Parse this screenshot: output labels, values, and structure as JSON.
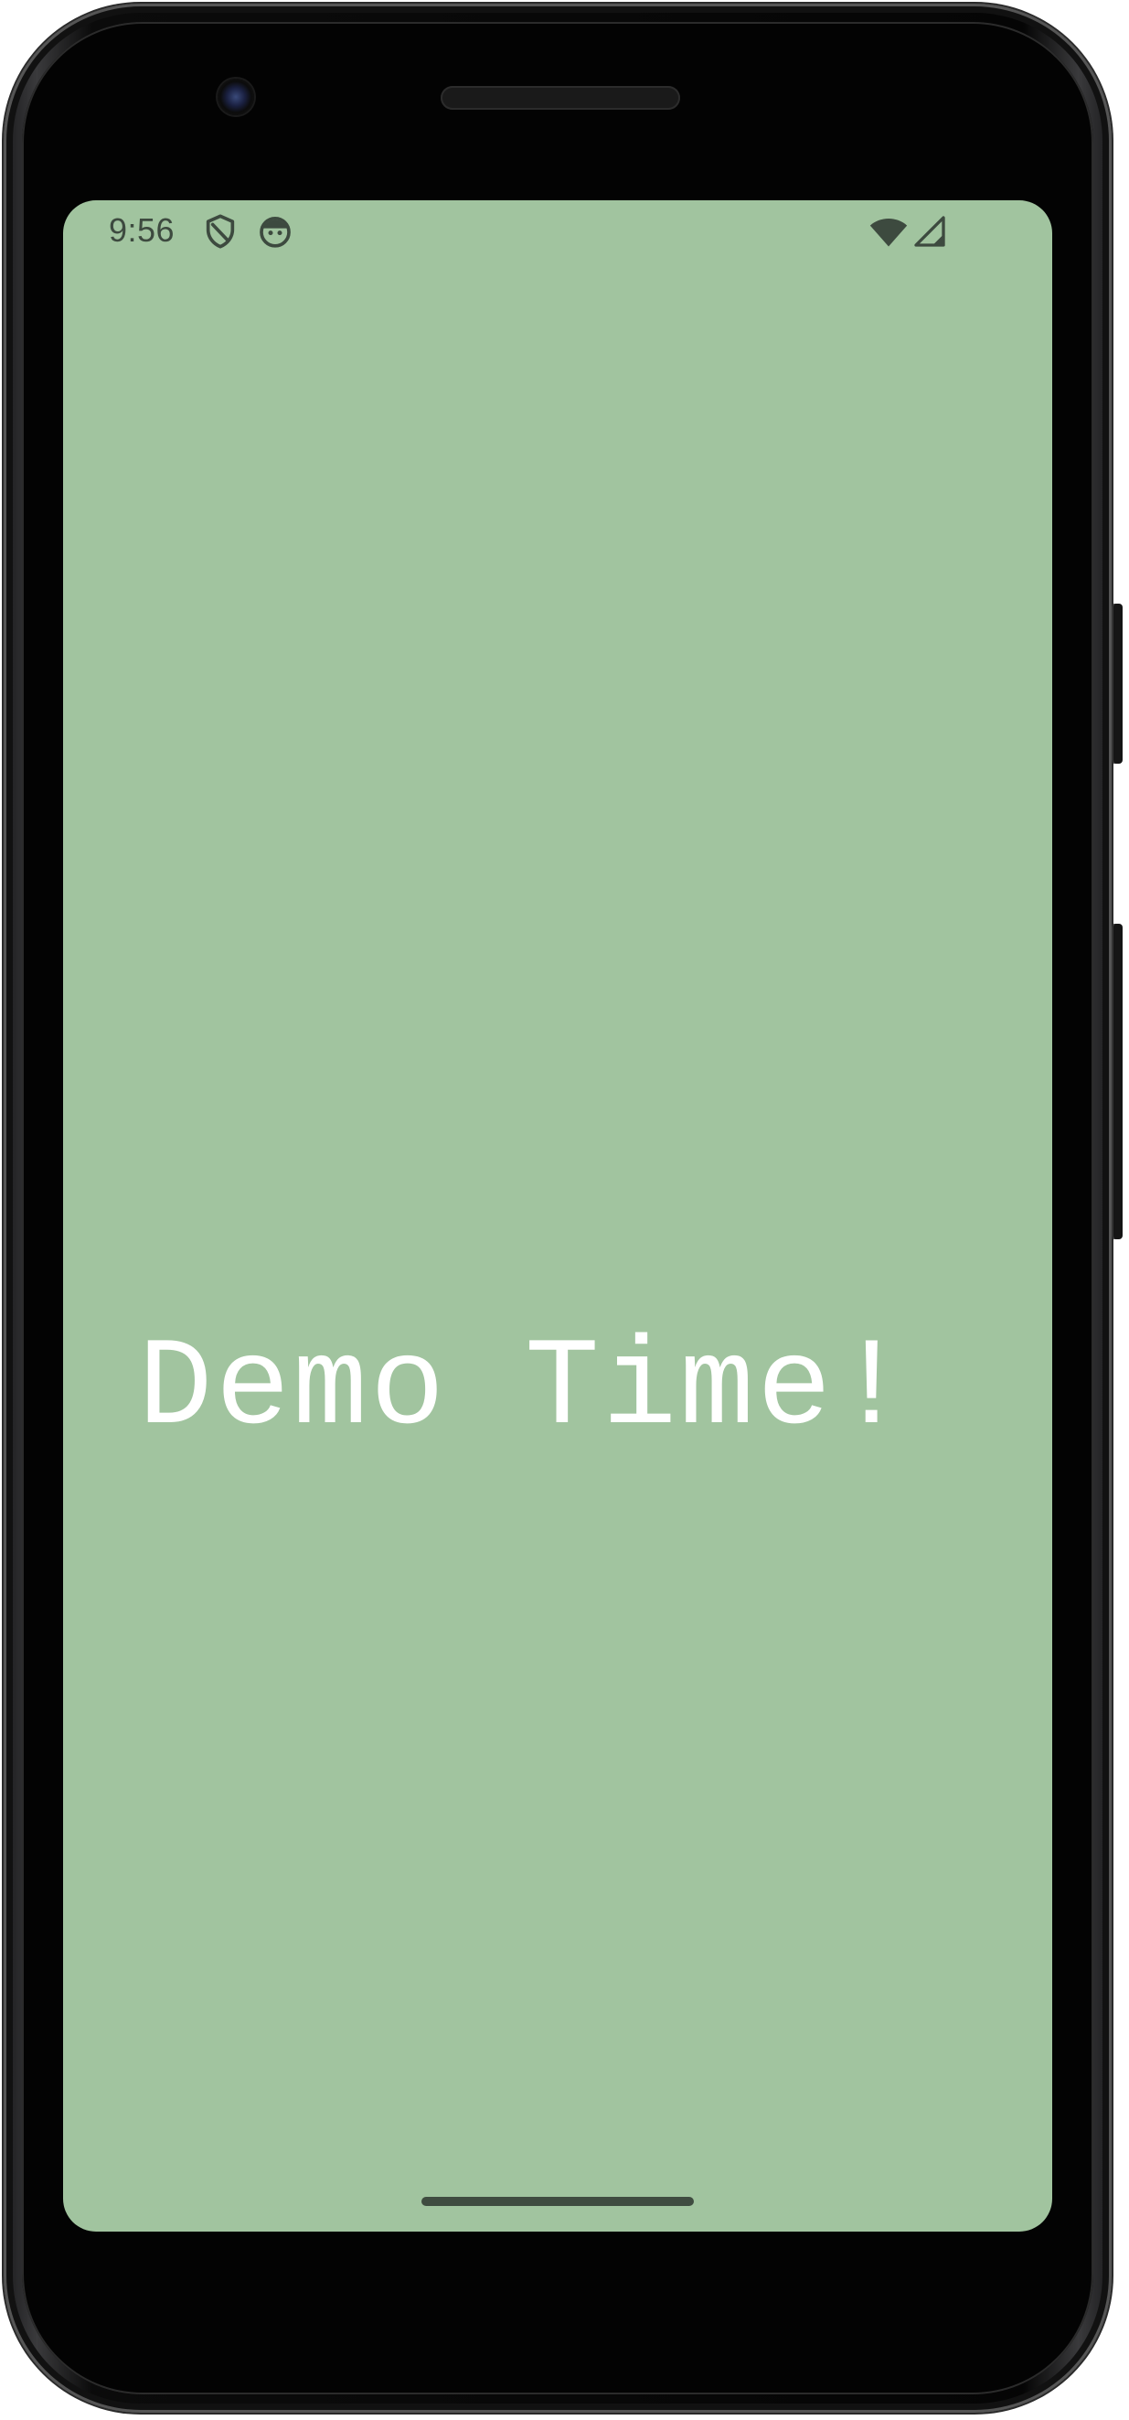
{
  "colors": {
    "screen_background": "#a1c49f",
    "status_foreground": "#3d4a3f",
    "headline_color": "#ffffff",
    "nav_handle": "#3f4c40"
  },
  "status_bar": {
    "time": "9:56",
    "left_icons": [
      "shield-icon",
      "face-icon"
    ],
    "right_icons": [
      "wifi-icon",
      "cellular-signal-icon"
    ]
  },
  "content": {
    "headline": "Demo Time!"
  },
  "navigation": {
    "gesture_handle": "home-gesture-handle"
  }
}
